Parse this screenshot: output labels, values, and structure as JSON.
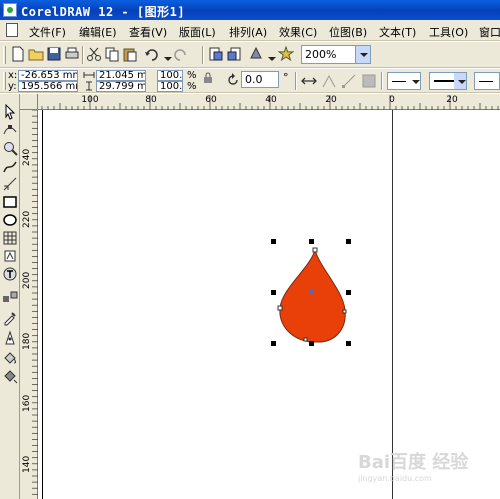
{
  "titlebar": {
    "text": "CorelDRAW 12 - [图形1]"
  },
  "menu": [
    {
      "label": "文件(F)"
    },
    {
      "label": "编辑(E)"
    },
    {
      "label": "查看(V)"
    },
    {
      "label": "版面(L)"
    },
    {
      "label": "排列(A)"
    },
    {
      "label": "效果(C)"
    },
    {
      "label": "位图(B)"
    },
    {
      "label": "文本(T)"
    },
    {
      "label": "工具(O)"
    },
    {
      "label": "窗口"
    }
  ],
  "toolbar": {
    "zoom_level": "200%"
  },
  "property_bar": {
    "x_label": "x:",
    "x_value": "-26.653 mm",
    "y_label": "y:",
    "y_value": "195.566 mm",
    "width_value": "21.045 mm",
    "height_value": "29.799 mm",
    "scale_x": "100.0",
    "scale_y": "100.0",
    "percent_sign": "%",
    "rotation_value": "0.0",
    "degree_sign": "°"
  },
  "rulers": {
    "horizontal_labels": [
      "100",
      "80",
      "60",
      "40",
      "20",
      "0",
      "20"
    ],
    "vertical_labels": [
      "240",
      "220",
      "200",
      "180",
      "160",
      "140"
    ]
  },
  "watermark": {
    "text": "Bai百度 经验",
    "sub": "jingyan.baidu.com"
  },
  "colors": {
    "drop_fill": "#e84008",
    "drop_stroke": "#7a2a10",
    "title_bar": "#0a50d8",
    "center_marker": "#3d6fd0"
  },
  "icons": [
    "app-icon",
    "new-icon",
    "open-icon",
    "save-icon",
    "print-icon",
    "cut-icon",
    "copy-icon",
    "paste-icon",
    "undo-icon",
    "redo-icon",
    "import-icon",
    "export-icon",
    "app-launcher-icon",
    "corel-online-icon",
    "pick-tool-icon",
    "shape-tool-icon",
    "zoom-tool-icon",
    "freehand-tool-icon",
    "smart-fill-icon",
    "rectangle-tool-icon",
    "ellipse-tool-icon",
    "polygon-tool-icon",
    "basic-shapes-icon",
    "text-tool-icon",
    "interactive-blend-icon",
    "eyedropper-icon",
    "outline-tool-icon",
    "fill-tool-icon",
    "interactive-fill-icon",
    "lock-ratio-icon",
    "rotation-icon",
    "mirror-icon",
    "line-style-icon"
  ]
}
